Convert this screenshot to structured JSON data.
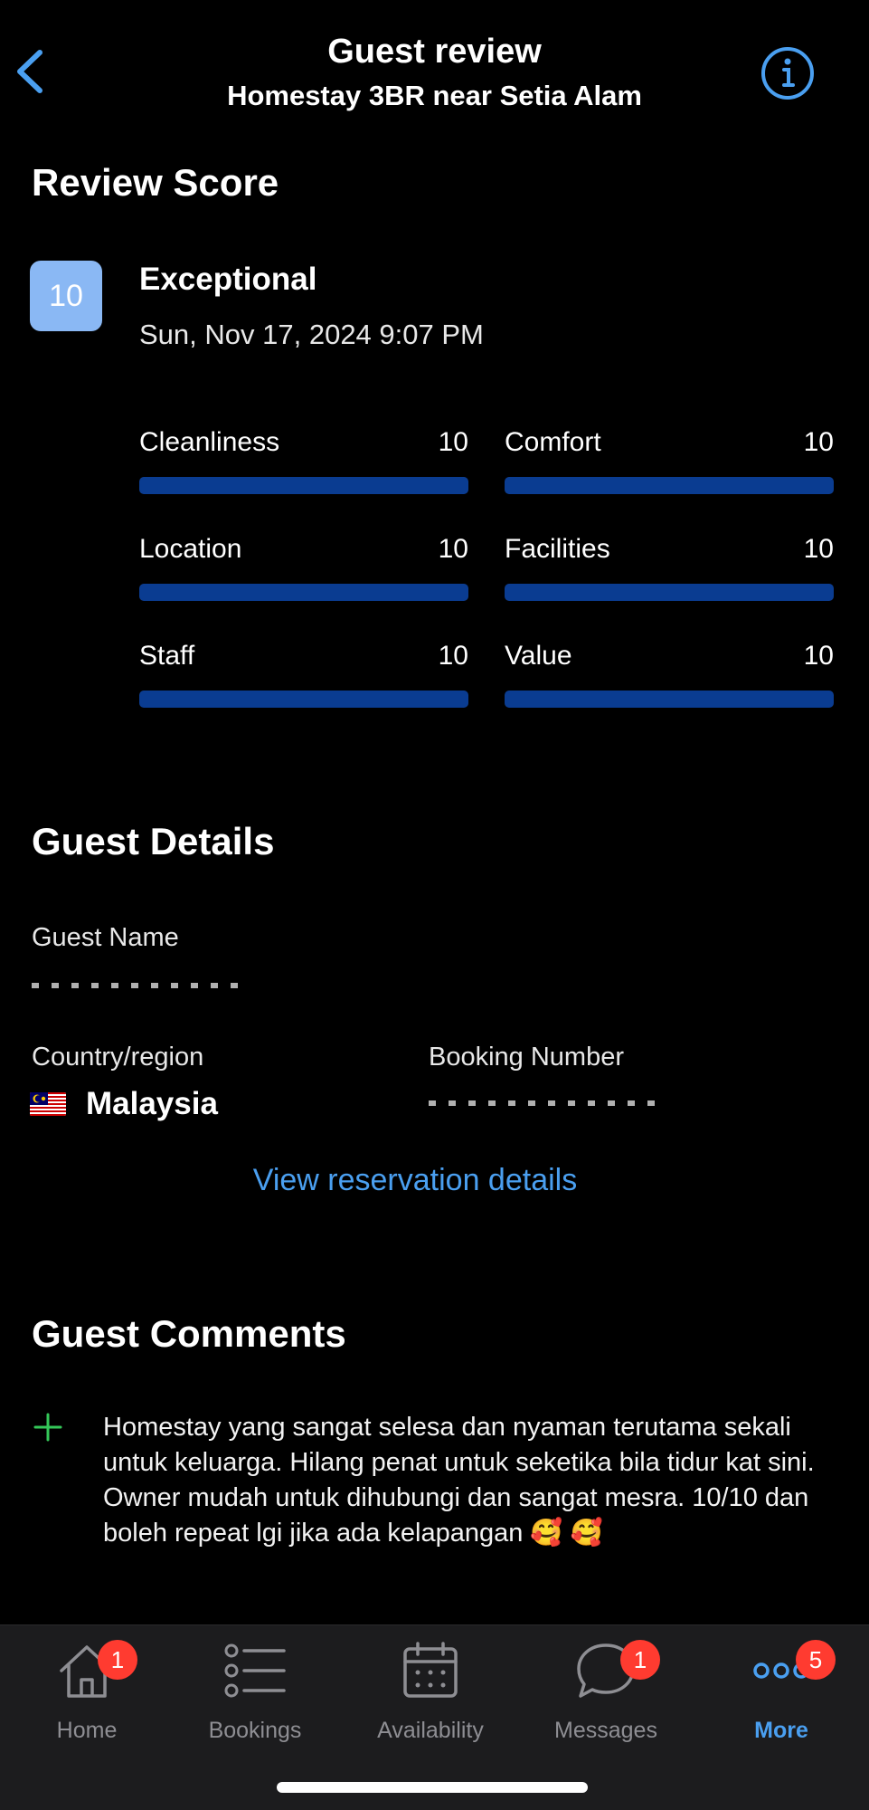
{
  "header": {
    "title": "Guest review",
    "subtitle": "Homestay 3BR near Setia Alam",
    "back_icon": "chevron-left-icon",
    "info_icon": "info-icon"
  },
  "review_score": {
    "section_title": "Review Score",
    "score": "10",
    "rating_word": "Exceptional",
    "date": "Sun, Nov 17, 2024 9:07 PM",
    "max_score": 10,
    "categories": [
      {
        "label": "Cleanliness",
        "value": "10",
        "fill_fraction": 1.0
      },
      {
        "label": "Comfort",
        "value": "10",
        "fill_fraction": 1.0
      },
      {
        "label": "Location",
        "value": "10",
        "fill_fraction": 1.0
      },
      {
        "label": "Facilities",
        "value": "10",
        "fill_fraction": 1.0
      },
      {
        "label": "Staff",
        "value": "10",
        "fill_fraction": 1.0
      },
      {
        "label": "Value",
        "value": "10",
        "fill_fraction": 1.0
      }
    ]
  },
  "guest_details": {
    "section_title": "Guest Details",
    "name_label": "Guest Name",
    "country_label": "Country/region",
    "country_value": "Malaysia",
    "booking_label": "Booking Number",
    "link_label": "View reservation details"
  },
  "guest_comments": {
    "section_title": "Guest Comments",
    "comment": "Homestay yang sangat selesa dan nyaman terutama sekali untuk keluarga. Hilang penat untuk seketika bila tidur kat sini. Owner mudah untuk dihubungi dan sangat mesra. 10/10 dan boleh repeat lgi jika ada kelapangan 🥰 🥰"
  },
  "tabbar": {
    "tabs": [
      {
        "label": "Home",
        "icon": "home-icon",
        "badge": "1"
      },
      {
        "label": "Bookings",
        "icon": "list-icon",
        "badge": ""
      },
      {
        "label": "Availability",
        "icon": "calendar-icon",
        "badge": ""
      },
      {
        "label": "Messages",
        "icon": "chat-bubble-icon",
        "badge": "1"
      },
      {
        "label": "More",
        "icon": "more-dots-icon",
        "badge": "5"
      }
    ]
  },
  "colors": {
    "accent": "#4a9ff0",
    "score_box": "#8ab8f4",
    "bar_fill": "#0a3c91",
    "badge": "#ff3b30",
    "plus": "#34c759"
  }
}
